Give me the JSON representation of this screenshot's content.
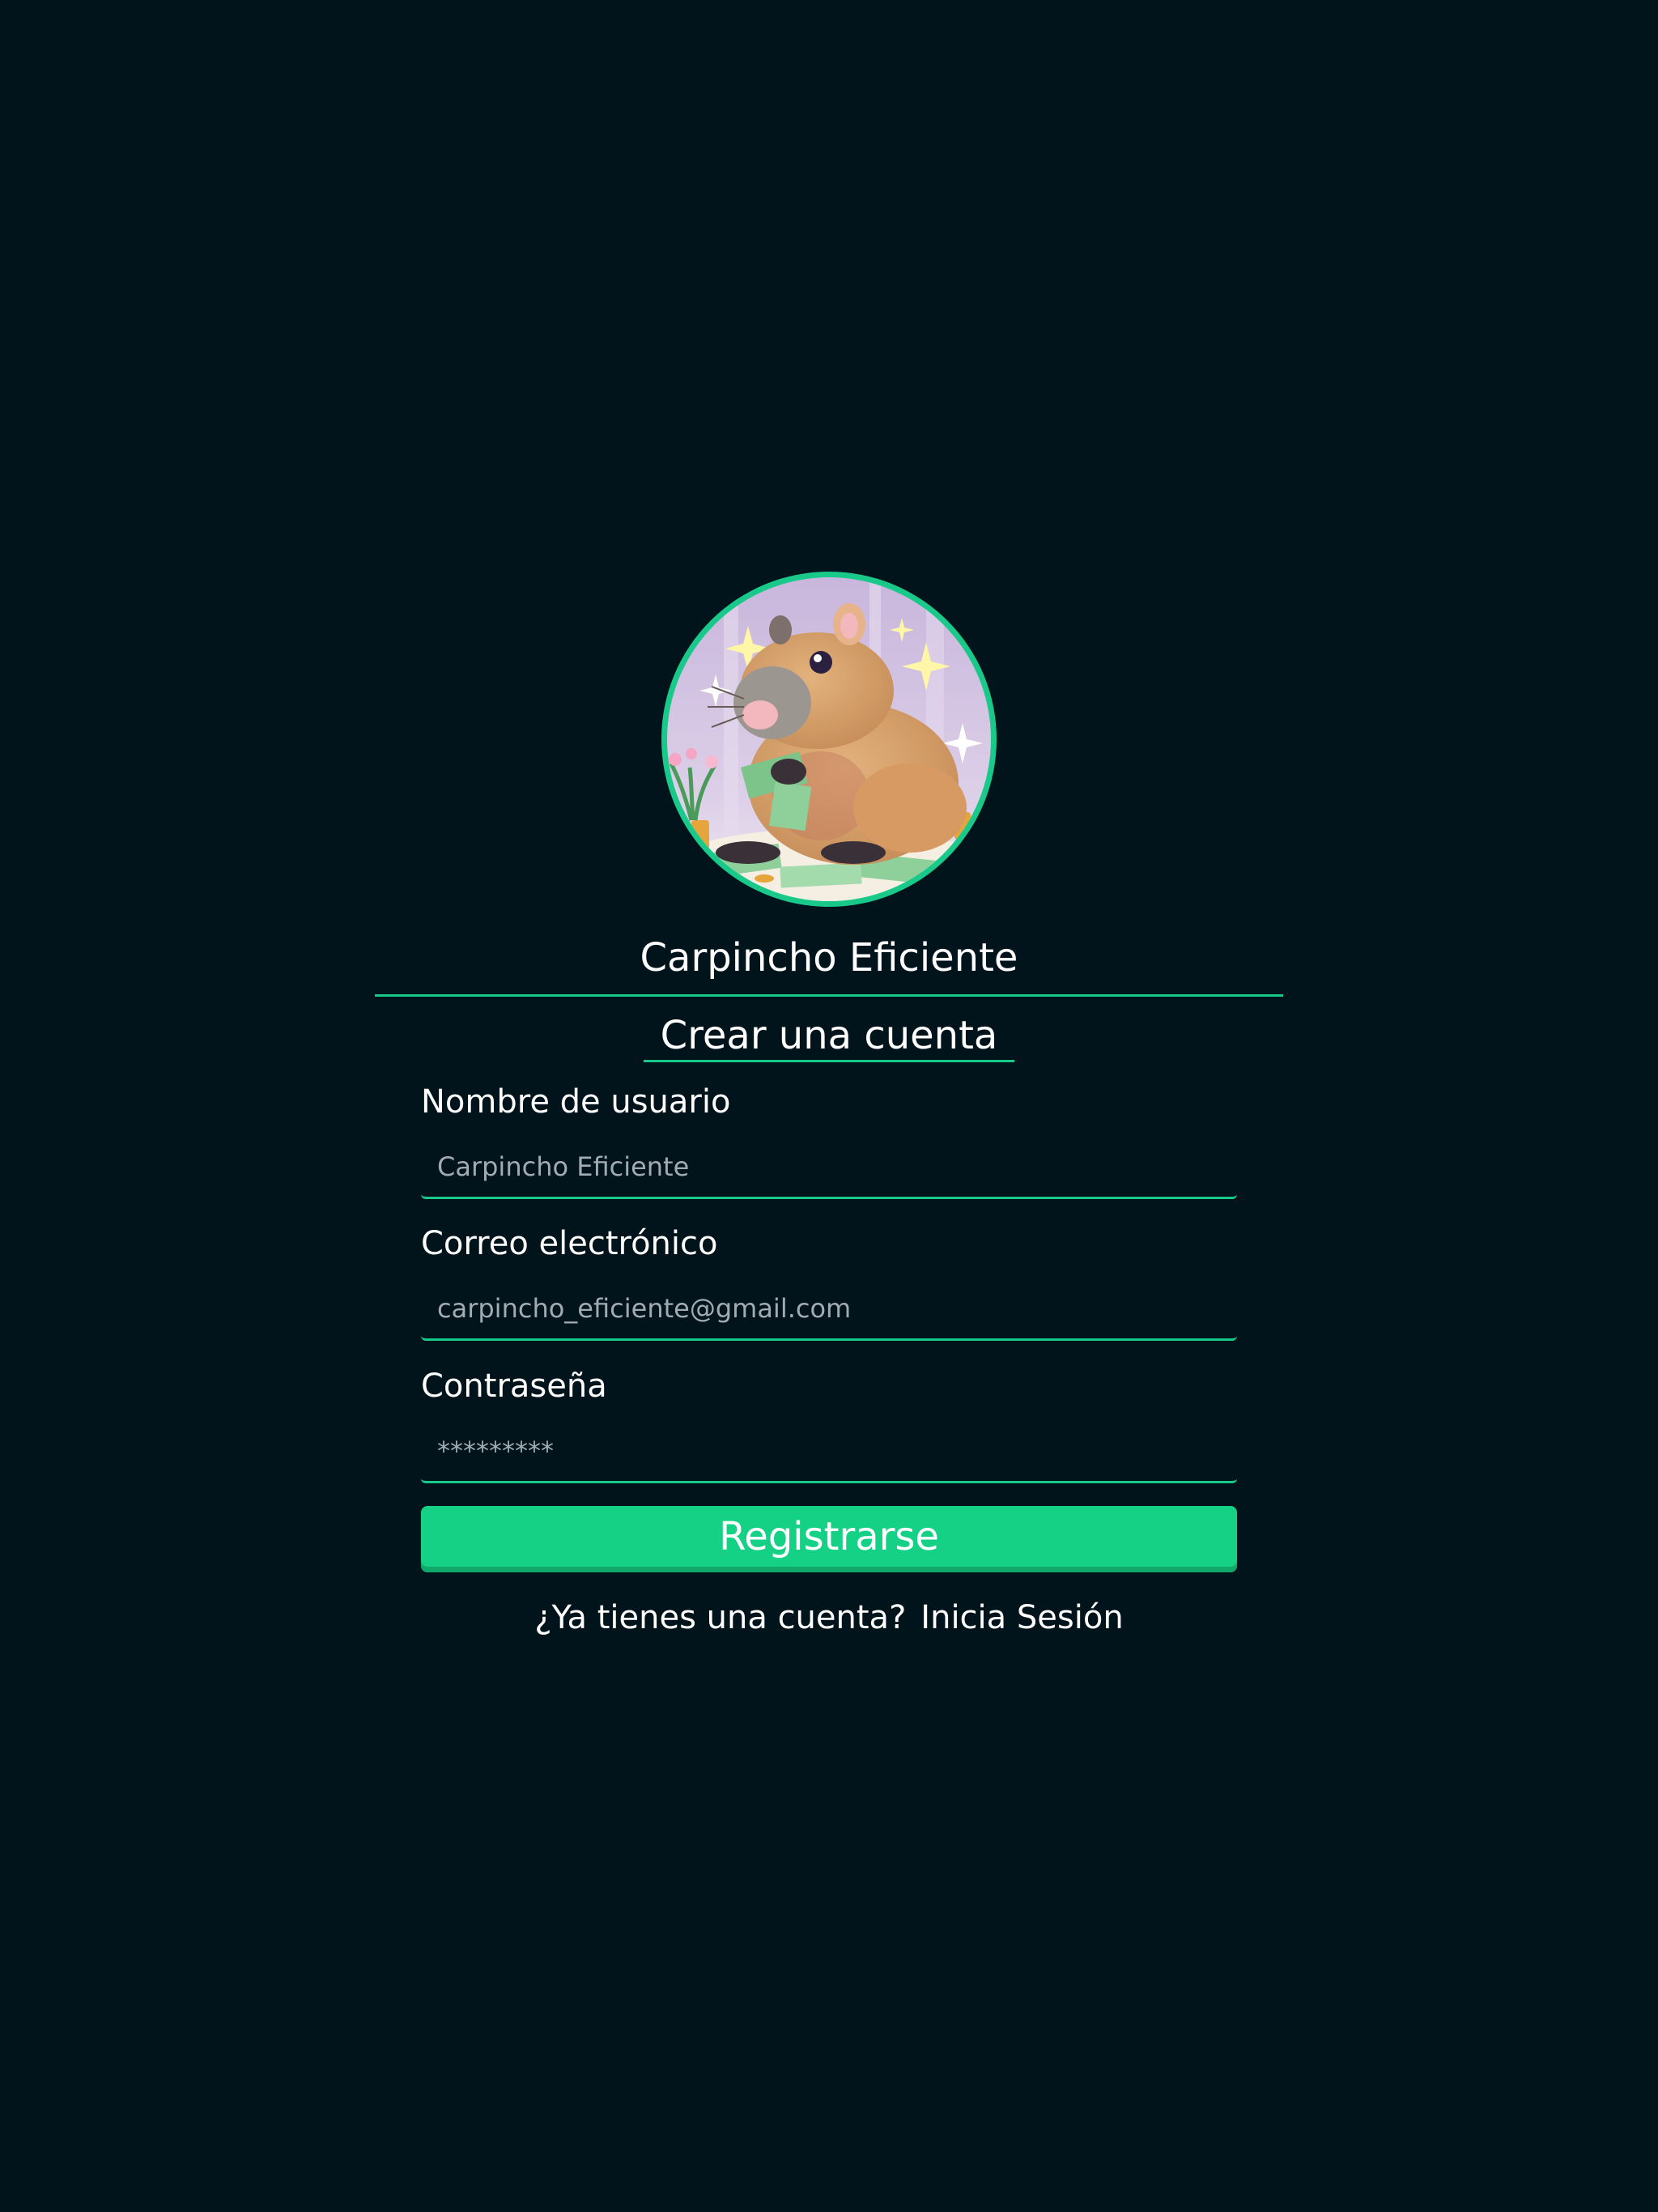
{
  "brand": {
    "app_name": "Carpincho Eficiente",
    "accent_color": "#19c98a",
    "background_color": "#01141c"
  },
  "avatar": {
    "icon": "capybara-counting-money-illustration"
  },
  "form": {
    "title": "Crear una cuenta",
    "fields": [
      {
        "label": "Nombre de usuario",
        "placeholder": "Carpincho Eficiente",
        "value": ""
      },
      {
        "label": "Correo electrónico",
        "placeholder": "carpincho_eficiente@gmail.com",
        "value": ""
      },
      {
        "label": "Contraseña",
        "placeholder": "*********",
        "value": ""
      }
    ],
    "submit_label": "Registrarse"
  },
  "login_prompt": {
    "question": "¿Ya tienes una cuenta?",
    "link_label": "Inicia Sesión"
  }
}
